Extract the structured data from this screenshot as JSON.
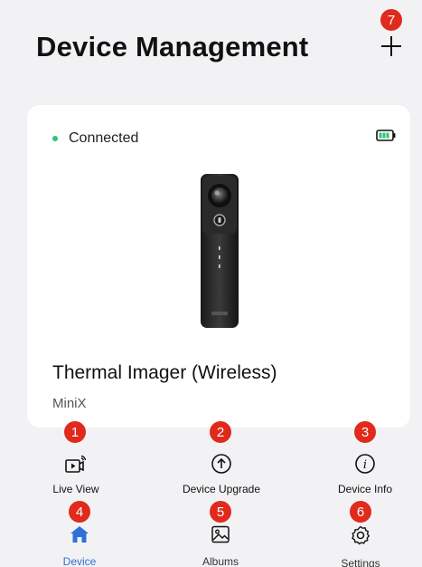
{
  "header": {
    "title": "Device Management",
    "add_icon": "plus-icon"
  },
  "device": {
    "status": "Connected",
    "status_color": "#2ec27a",
    "battery_icon": "battery-full-icon",
    "name": "Thermal Imager (Wireless)",
    "model": "MiniX"
  },
  "actions": [
    {
      "label": "Live View",
      "icon": "live-view-icon"
    },
    {
      "label": "Device Upgrade",
      "icon": "upgrade-arrow-icon"
    },
    {
      "label": "Device Info",
      "icon": "info-icon"
    }
  ],
  "tabbar": [
    {
      "label": "Device",
      "icon": "home-icon",
      "active": true
    },
    {
      "label": "Albums",
      "icon": "image-icon",
      "active": false
    },
    {
      "label": "Settings",
      "icon": "gear-icon",
      "active": false
    }
  ],
  "markers": [
    "1",
    "2",
    "3",
    "4",
    "5",
    "6",
    "7"
  ],
  "colors": {
    "accent": "#2f6fd8",
    "marker": "#e02a1c",
    "background": "#f2f2f4"
  }
}
